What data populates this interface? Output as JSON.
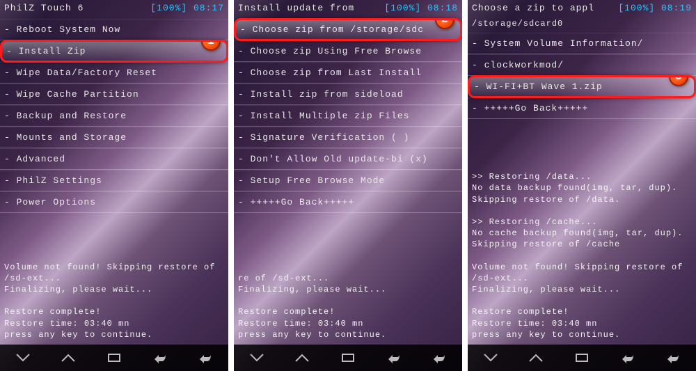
{
  "screens": [
    {
      "title": "PhilZ Touch 6",
      "battery": "[100%]",
      "time": "08:17",
      "path": "",
      "menu": [
        {
          "label": "- Reboot System Now",
          "highlighted": false
        },
        {
          "label": "- Install Zip",
          "highlighted": true,
          "badge": "1"
        },
        {
          "label": "- Wipe Data/Factory Reset",
          "highlighted": false
        },
        {
          "label": "- Wipe Cache Partition",
          "highlighted": false
        },
        {
          "label": "- Backup and Restore",
          "highlighted": false
        },
        {
          "label": "- Mounts and Storage",
          "highlighted": false
        },
        {
          "label": "- Advanced",
          "highlighted": false
        },
        {
          "label": "- PhilZ Settings",
          "highlighted": false
        },
        {
          "label": "- Power Options",
          "highlighted": false
        }
      ],
      "console": "Volume not found! Skipping restore of /sd-ext...\nFinalizing, please wait...\n\nRestore complete!\nRestore time: 03:40 mn\npress any key to continue."
    },
    {
      "title": "Install update from",
      "battery": "[100%]",
      "time": "08:18",
      "path": "",
      "menu": [
        {
          "label": "- Choose zip from /storage/sdc",
          "highlighted": true,
          "badge": "2"
        },
        {
          "label": "- Choose zip Using Free Browse",
          "highlighted": false
        },
        {
          "label": "- Choose zip from Last Install",
          "highlighted": false
        },
        {
          "label": "- Install zip from sideload",
          "highlighted": false
        },
        {
          "label": "- Install Multiple zip Files",
          "highlighted": false
        },
        {
          "label": "- Signature Verification   ( )",
          "highlighted": false
        },
        {
          "label": "- Don't Allow Old update-bi (x)",
          "highlighted": false
        },
        {
          "label": "- Setup Free Browse Mode",
          "highlighted": false
        },
        {
          "label": "- +++++Go Back+++++",
          "highlighted": false
        }
      ],
      "console": "re of /sd-ext...\nFinalizing, please wait...\n\nRestore complete!\nRestore time: 03:40 mn\npress any key to continue."
    },
    {
      "title": "Choose a zip to appl",
      "battery": "[100%]",
      "time": "08:19",
      "path": "/storage/sdcard0",
      "menu": [
        {
          "label": "- System Volume Information/",
          "highlighted": false
        },
        {
          "label": "- clockworkmod/",
          "highlighted": false
        },
        {
          "label": "- WI-FI+BT Wave 1.zip",
          "highlighted": true,
          "badge": "3"
        },
        {
          "label": "- +++++Go Back+++++",
          "highlighted": false
        }
      ],
      "console": ">> Restoring /data...\nNo data backup found(img, tar, dup). Skipping restore of /data.\n\n>> Restoring /cache...\nNo cache backup found(img, tar, dup). Skipping restore of /cache\n\nVolume not found! Skipping restore of /sd-ext...\nFinalizing, please wait...\n\nRestore complete!\nRestore time: 03:40 mn\npress any key to continue."
    }
  ]
}
